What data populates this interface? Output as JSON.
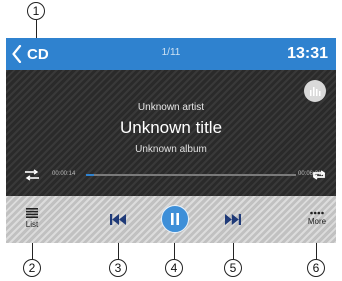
{
  "callouts": [
    "1",
    "2",
    "3",
    "4",
    "5",
    "6"
  ],
  "header": {
    "source_label": "CD",
    "track_index": "1/11",
    "clock": "13:31"
  },
  "now_playing": {
    "artist": "Unknown artist",
    "title": "Unknown title",
    "album": "Unknown album"
  },
  "playback": {
    "elapsed": "00:00:14",
    "total": "00:06:21",
    "progress_fraction": 0.04
  },
  "controls": {
    "list_label": "List",
    "more_label": "More"
  },
  "colors": {
    "accent": "#2f82cf",
    "button_icons": "#1f3a78",
    "screen_bg": "#303030",
    "control_bar": "#c9c9c9"
  },
  "icons": [
    "back-chevron-icon",
    "equalizer-icon",
    "shuffle-icon",
    "repeat-icon",
    "list-icon",
    "previous-track-icon",
    "pause-icon",
    "next-track-icon",
    "more-dots-icon"
  ]
}
